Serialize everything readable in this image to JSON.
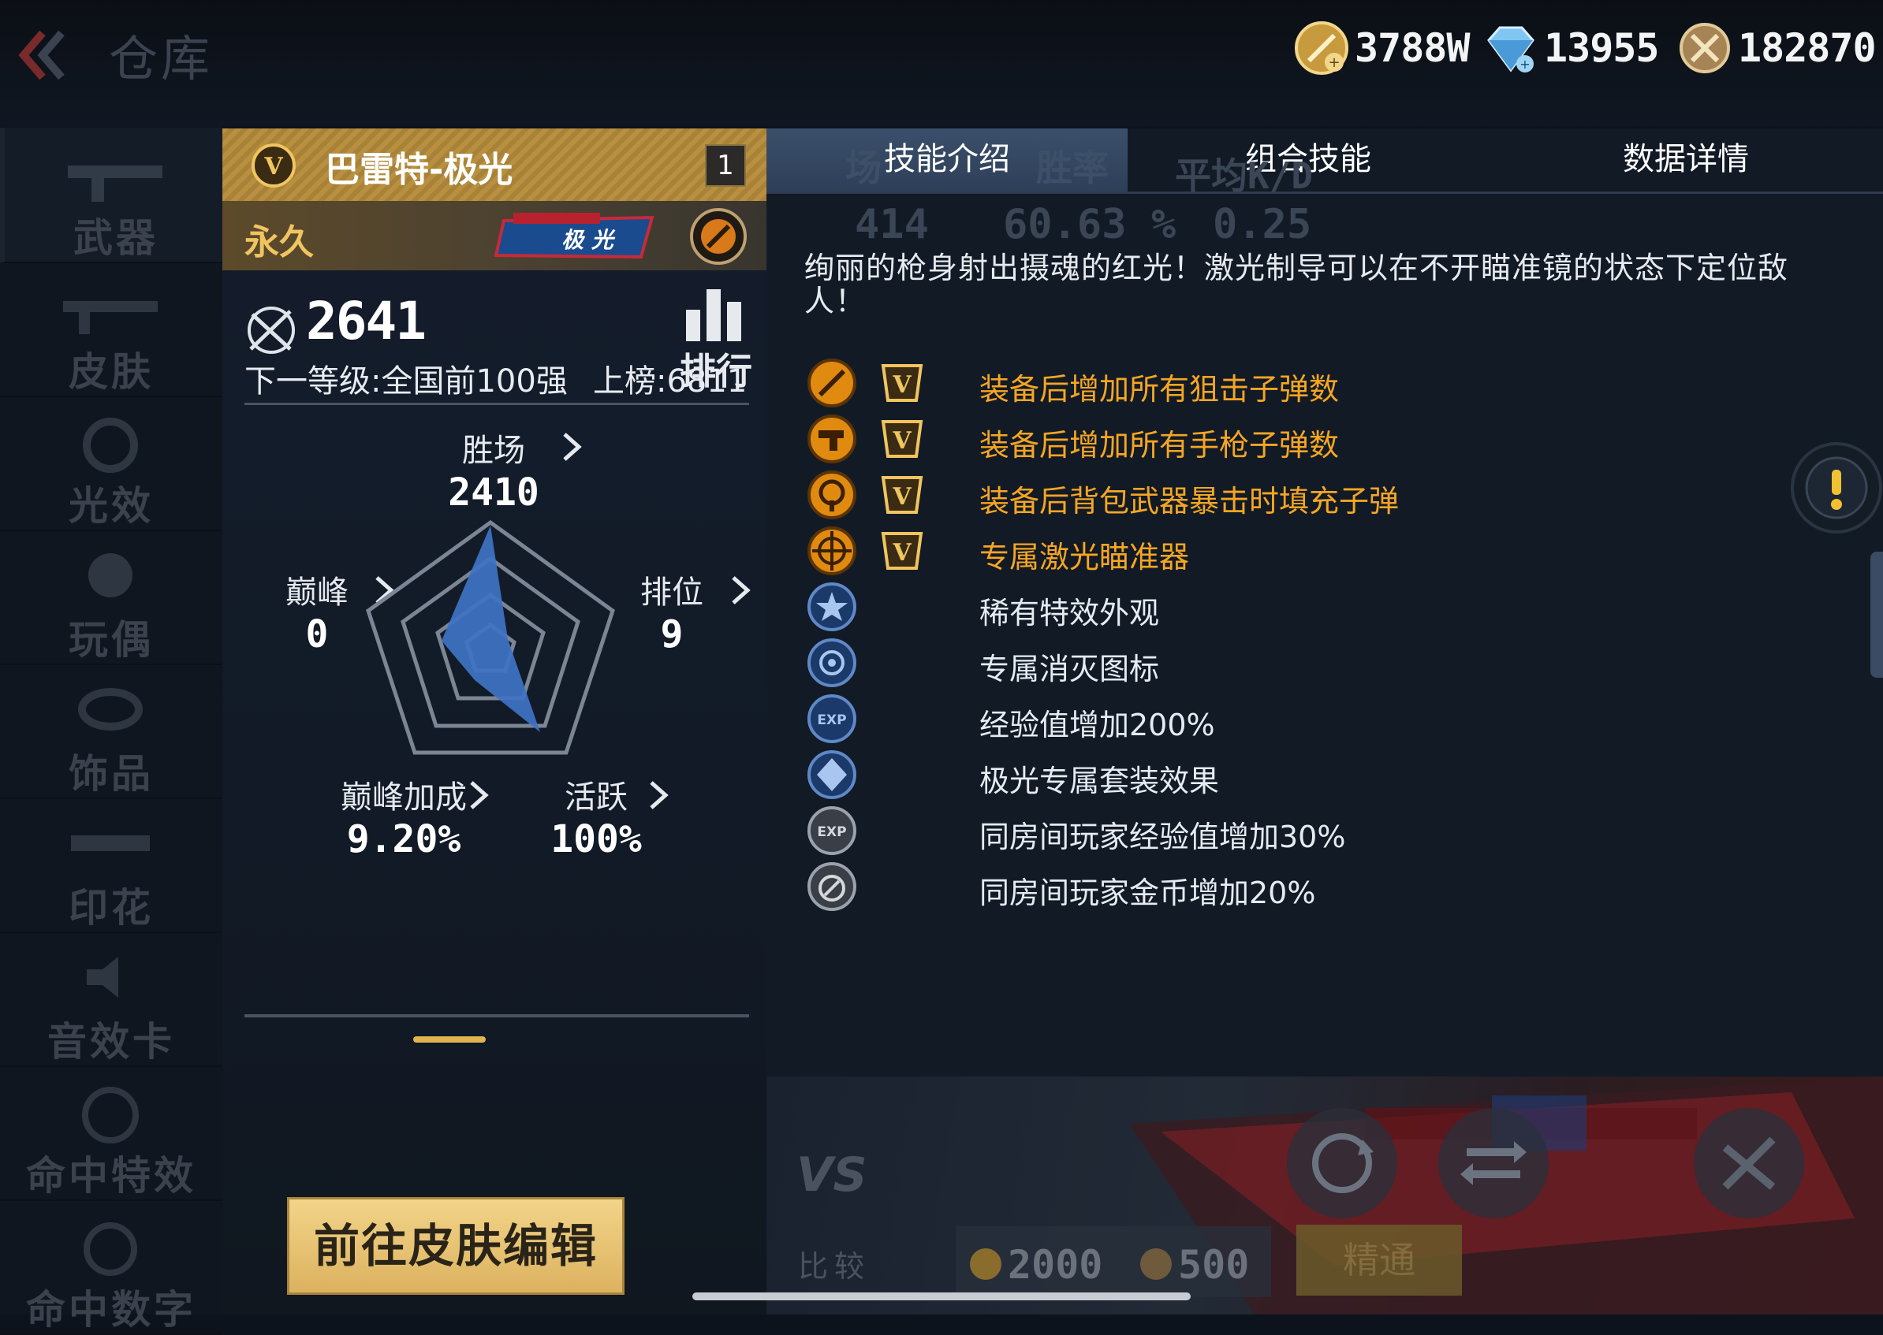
{
  "header": {
    "title": "仓库",
    "back_icon": "double-chevron-left-icon",
    "currencies": [
      {
        "icon": "gold-coin-icon",
        "value": "3788W"
      },
      {
        "icon": "diamond-icon",
        "value": "13955"
      },
      {
        "icon": "honor-coin-icon",
        "value": "182870"
      }
    ]
  },
  "sidebar": {
    "items": [
      {
        "label": "武器",
        "icon": "rifle-icon",
        "active": true
      },
      {
        "label": "皮肤",
        "icon": "gun-skin-icon"
      },
      {
        "label": "光效",
        "icon": "light-effect-icon"
      },
      {
        "label": "玩偶",
        "icon": "doll-icon"
      },
      {
        "label": "饰品",
        "icon": "ornament-icon"
      },
      {
        "label": "印花",
        "icon": "decal-icon"
      },
      {
        "label": "音效卡",
        "icon": "sound-card-icon"
      },
      {
        "label": "命中特效",
        "icon": "hit-effect-icon"
      },
      {
        "label": "命中数字",
        "icon": "hit-number-icon"
      }
    ]
  },
  "weapon": {
    "name": "巴雷特-极光",
    "count": "1",
    "duration": "永久",
    "skin_tag": "极 光",
    "score": "2641",
    "rank_label": "排行",
    "next_level": "下一等级:全国前100强",
    "on_board": "上榜:6811",
    "stats": {
      "wins": {
        "label": "胜场",
        "value": "2410"
      },
      "peak": {
        "label": "巅峰",
        "value": "0"
      },
      "rank": {
        "label": "排位",
        "value": "9"
      },
      "peak_bonus": {
        "label": "巅峰加成",
        "value": "9.20%"
      },
      "active": {
        "label": "活跃",
        "value": "100%"
      }
    },
    "edit_button": "前往皮肤编辑"
  },
  "tabs": [
    {
      "label": "技能介绍",
      "active": true
    },
    {
      "label": "组合技能"
    },
    {
      "label": "数据详情"
    }
  ],
  "ghost_stats": {
    "labels": [
      "场",
      "胜率",
      "平均K/D"
    ],
    "values": [
      "414",
      "60.63 %",
      "0.25"
    ]
  },
  "description": "绚丽的枪身射出摄魂的红光！激光制导可以在不开瞄准镜的状态下定位敌人！",
  "skills": [
    {
      "icon": "sniper-bullet-icon",
      "vip": true,
      "text": "装备后增加所有狙击子弹数",
      "highlight": true
    },
    {
      "icon": "pistol-icon",
      "vip": true,
      "text": "装备后增加所有手枪子弹数",
      "highlight": true
    },
    {
      "icon": "crit-refill-icon",
      "vip": true,
      "text": "装备后背包武器暴击时填充子弹",
      "highlight": true
    },
    {
      "icon": "laser-crosshair-icon",
      "vip": true,
      "text": "专属激光瞄准器",
      "highlight": true
    },
    {
      "icon": "star-icon",
      "vip": false,
      "text": "稀有特效外观",
      "highlight": false
    },
    {
      "icon": "kill-mark-icon",
      "vip": false,
      "text": "专属消灭图标",
      "highlight": false
    },
    {
      "icon": "exp-icon",
      "vip": false,
      "text": "经验值增加200%",
      "highlight": false
    },
    {
      "icon": "diamond-suit-icon",
      "vip": false,
      "text": "极光专属套装效果",
      "highlight": false
    },
    {
      "icon": "room-exp-icon",
      "vip": false,
      "text": "同房间玩家经验值增加30%",
      "highlight": false
    },
    {
      "icon": "room-coin-icon",
      "vip": false,
      "text": "同房间玩家金币增加20%",
      "highlight": false
    }
  ],
  "bottom": {
    "compare_vs": "VS",
    "compare_label": "比较",
    "price_gold": "2000",
    "price_honor": "500",
    "master_button": "精通"
  },
  "colors": {
    "gold_text": "#f5a623",
    "tab_active": "#34486a",
    "button_gold": "#e6c070",
    "radar_fill": "#3f73c4"
  }
}
